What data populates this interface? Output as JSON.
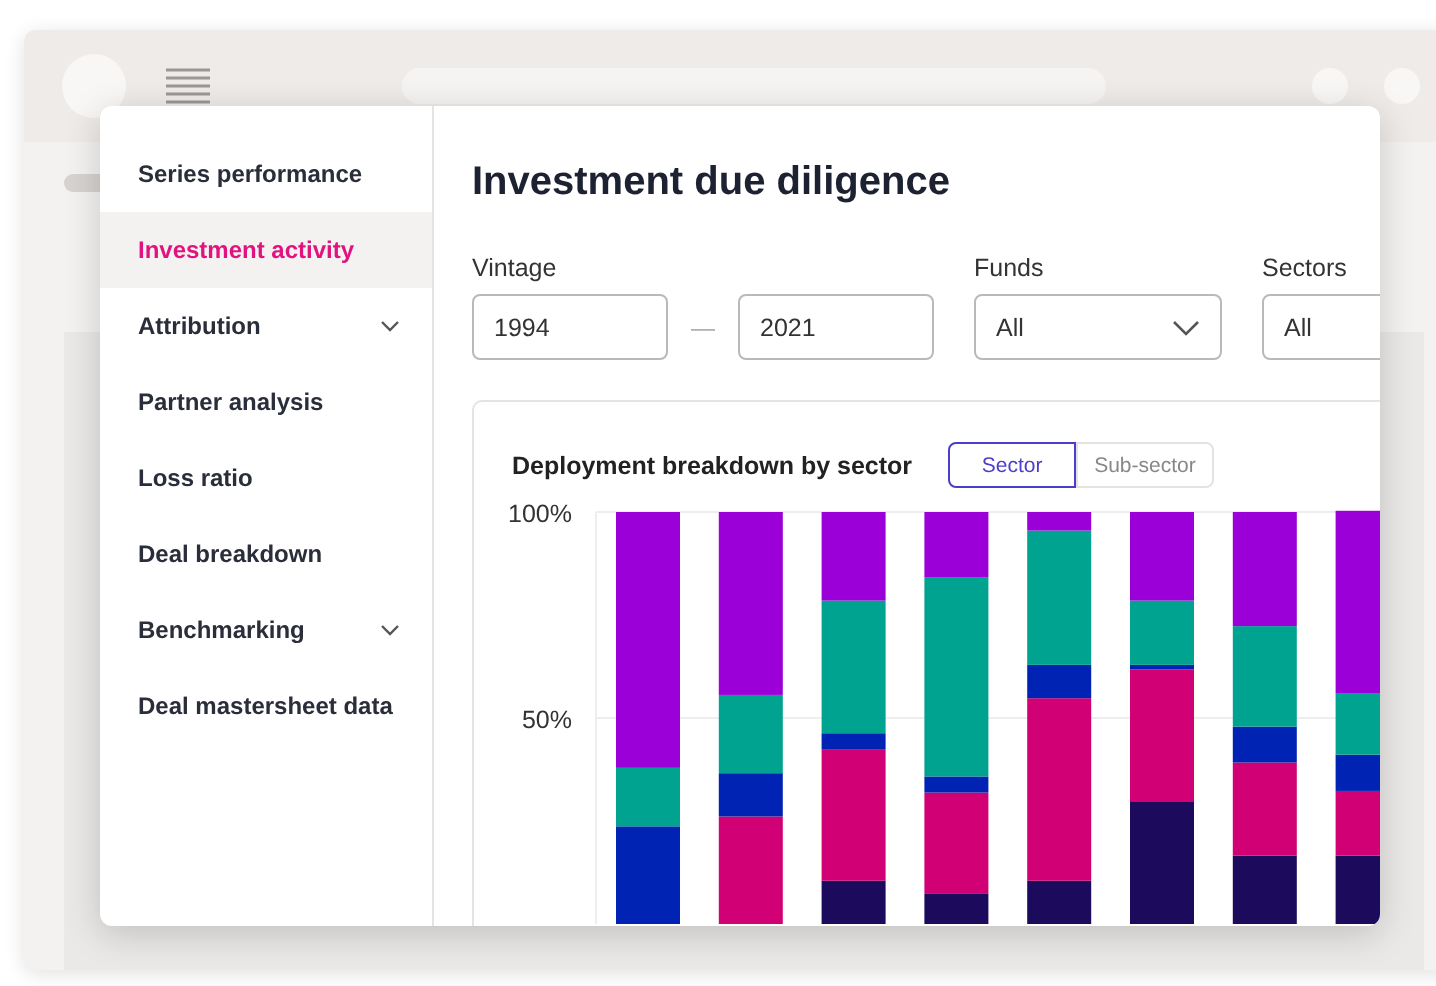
{
  "sidebar": {
    "items": [
      {
        "label": "Series performance",
        "selected": false,
        "expandable": false
      },
      {
        "label": "Investment activity",
        "selected": true,
        "expandable": false
      },
      {
        "label": "Attribution",
        "selected": false,
        "expandable": true
      },
      {
        "label": "Partner analysis",
        "selected": false,
        "expandable": false
      },
      {
        "label": "Loss ratio",
        "selected": false,
        "expandable": false
      },
      {
        "label": "Deal breakdown",
        "selected": false,
        "expandable": false
      },
      {
        "label": "Benchmarking",
        "selected": false,
        "expandable": true
      },
      {
        "label": "Deal mastersheet data",
        "selected": false,
        "expandable": false
      }
    ]
  },
  "page_title": "Investment due diligence",
  "filters": {
    "vintage": {
      "label": "Vintage",
      "from": "1994",
      "separator": "—",
      "to": "2021"
    },
    "funds": {
      "label": "Funds",
      "value": "All"
    },
    "sectors": {
      "label": "Sectors",
      "value": "All"
    }
  },
  "chart_card": {
    "title": "Deployment breakdown by sector",
    "toggle": [
      {
        "label": "Sector",
        "selected": true
      },
      {
        "label": "Sub-sector",
        "selected": false
      }
    ],
    "chart_data": {
      "type": "bar",
      "stacked": true,
      "ylim": [
        0,
        100
      ],
      "yticks": [
        {
          "value": 50,
          "label": "50%"
        },
        {
          "value": 100,
          "label": "100%"
        }
      ],
      "series": [
        {
          "color": "#1c0a5c",
          "values": [
            null,
            null,
            10.5,
            7.3,
            10.5,
            29.8,
            16.6,
            16.6
          ]
        },
        {
          "color": "#d10075",
          "values": [
            null,
            26.1,
            31.8,
            24.6,
            44.3,
            32.0,
            22.6,
            15.7
          ]
        },
        {
          "color": "#0023b3",
          "values": [
            23.7,
            10.5,
            4.0,
            3.9,
            8.1,
            1.1,
            8.7,
            8.8
          ]
        },
        {
          "color": "#00a390",
          "values": [
            14.2,
            19.0,
            32.2,
            48.4,
            32.6,
            15.6,
            24.4,
            14.8
          ]
        },
        {
          "color": "#9b00d9",
          "values": [
            62.1,
            44.4,
            21.5,
            15.8,
            4.5,
            21.5,
            27.7,
            44.4
          ]
        }
      ]
    }
  }
}
